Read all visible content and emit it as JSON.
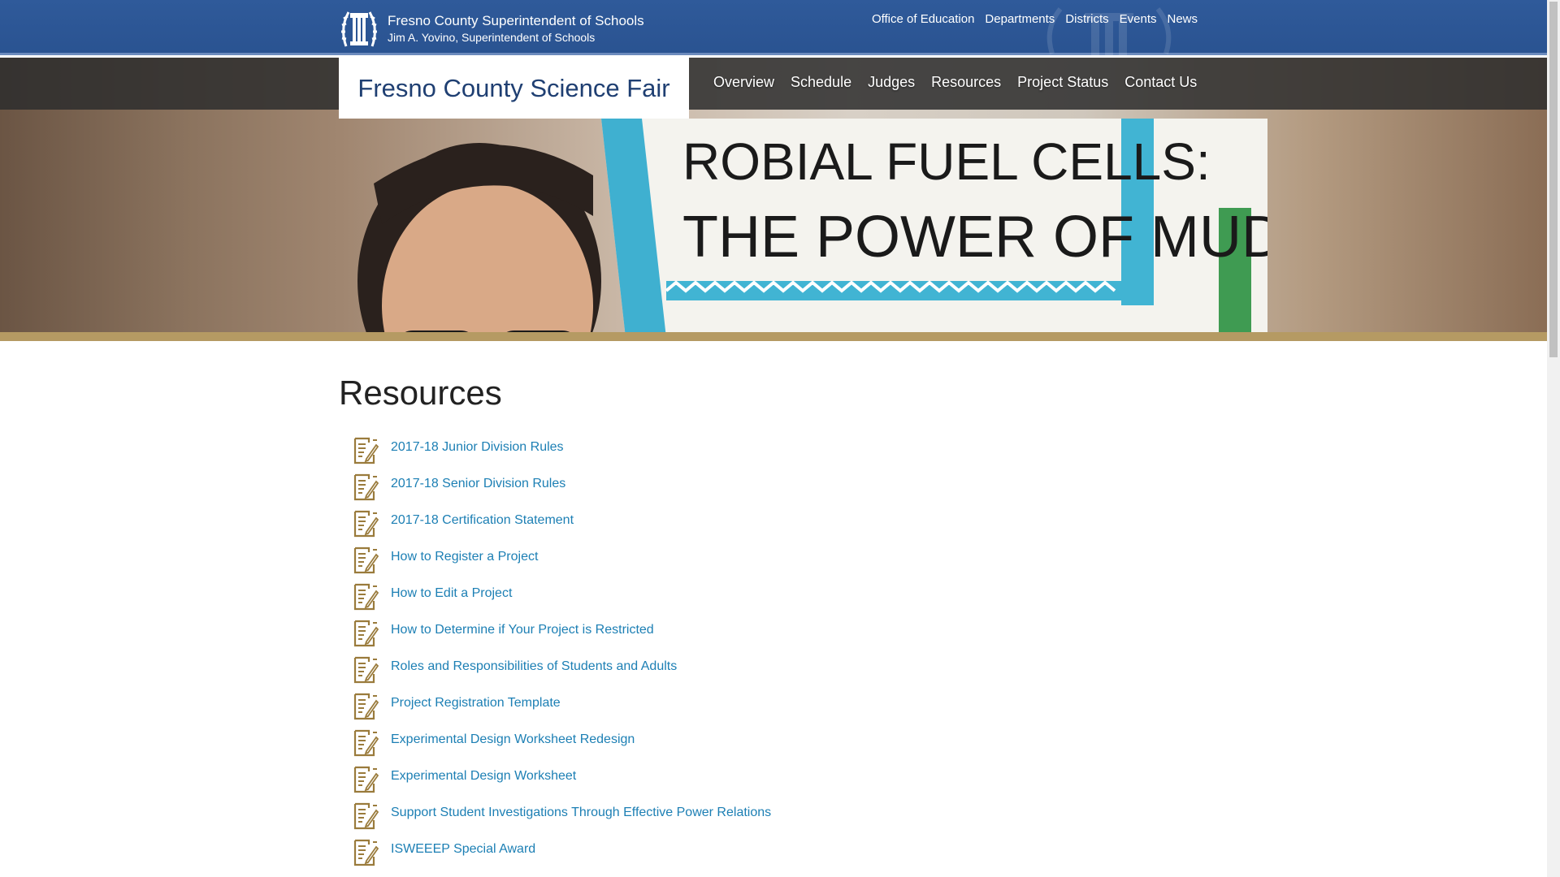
{
  "header": {
    "org_name": "Fresno County Superintendent of Schools",
    "org_sub": "Jim A. Yovino, Superintendent of Schools",
    "utility_nav": [
      "Office of Education",
      "Departments",
      "Districts",
      "Events",
      "News"
    ]
  },
  "site": {
    "title": "Fresno County Science Fair",
    "nav": [
      "Overview",
      "Schedule",
      "Judges",
      "Resources",
      "Project Status",
      "Contact Us"
    ]
  },
  "hero": {
    "sign_line1": "ROBIAL FUEL CELLS:",
    "sign_line2": "THE POWER OF MUD!"
  },
  "main": {
    "heading": "Resources",
    "resources": [
      "2017-18 Junior Division Rules",
      "2017-18 Senior Division Rules",
      "2017-18 Certification Statement",
      "How to Register a Project",
      "How to Edit a Project",
      "How to Determine if Your Project is Restricted",
      "Roles and Responsibilities of Students and Adults",
      "Project Registration Template",
      "Experimental Design Worksheet Redesign",
      "Experimental Design Worksheet",
      "Support Student Investigations Through Effective Power Relations",
      "ISWEEEP Special Award"
    ]
  },
  "colors": {
    "topbar": "#2f5a9a",
    "link": "#1c7fb4",
    "gold": "#b59a63",
    "title": "#1f3f72"
  },
  "icons": {
    "logo": "column-pillar-icon",
    "resource": "document-edit-icon"
  }
}
